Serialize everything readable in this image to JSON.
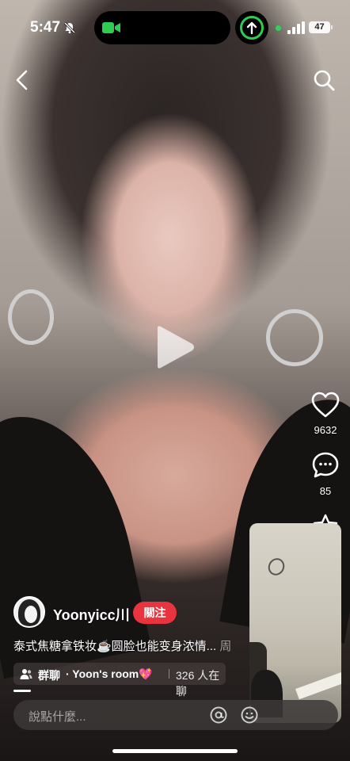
{
  "status_bar": {
    "time": "5:47",
    "battery": "47"
  },
  "post": {
    "likes": "9632",
    "comments": "85"
  },
  "author": {
    "name": "Yoonyicc川",
    "follow_label": "關注"
  },
  "caption": {
    "text": "泰式焦糖拿铁妆☕️圆脸也能变身浓情...",
    "trail": " 周"
  },
  "group_chat": {
    "label": "群聊",
    "room": "· Yoon's room💖",
    "online": "326 人在聊"
  },
  "comment_input": {
    "placeholder": "說點什麼..."
  },
  "icons": {
    "back": "chevron-left-icon",
    "search": "search-icon",
    "play": "play-icon",
    "like": "heart-icon",
    "comment": "chat-bubble-icon",
    "collect": "star-icon",
    "mention": "at-icon",
    "emoji": "emoji-icon"
  },
  "colors": {
    "follow": "#e8343f",
    "island_indicator": "#2ecc51"
  }
}
